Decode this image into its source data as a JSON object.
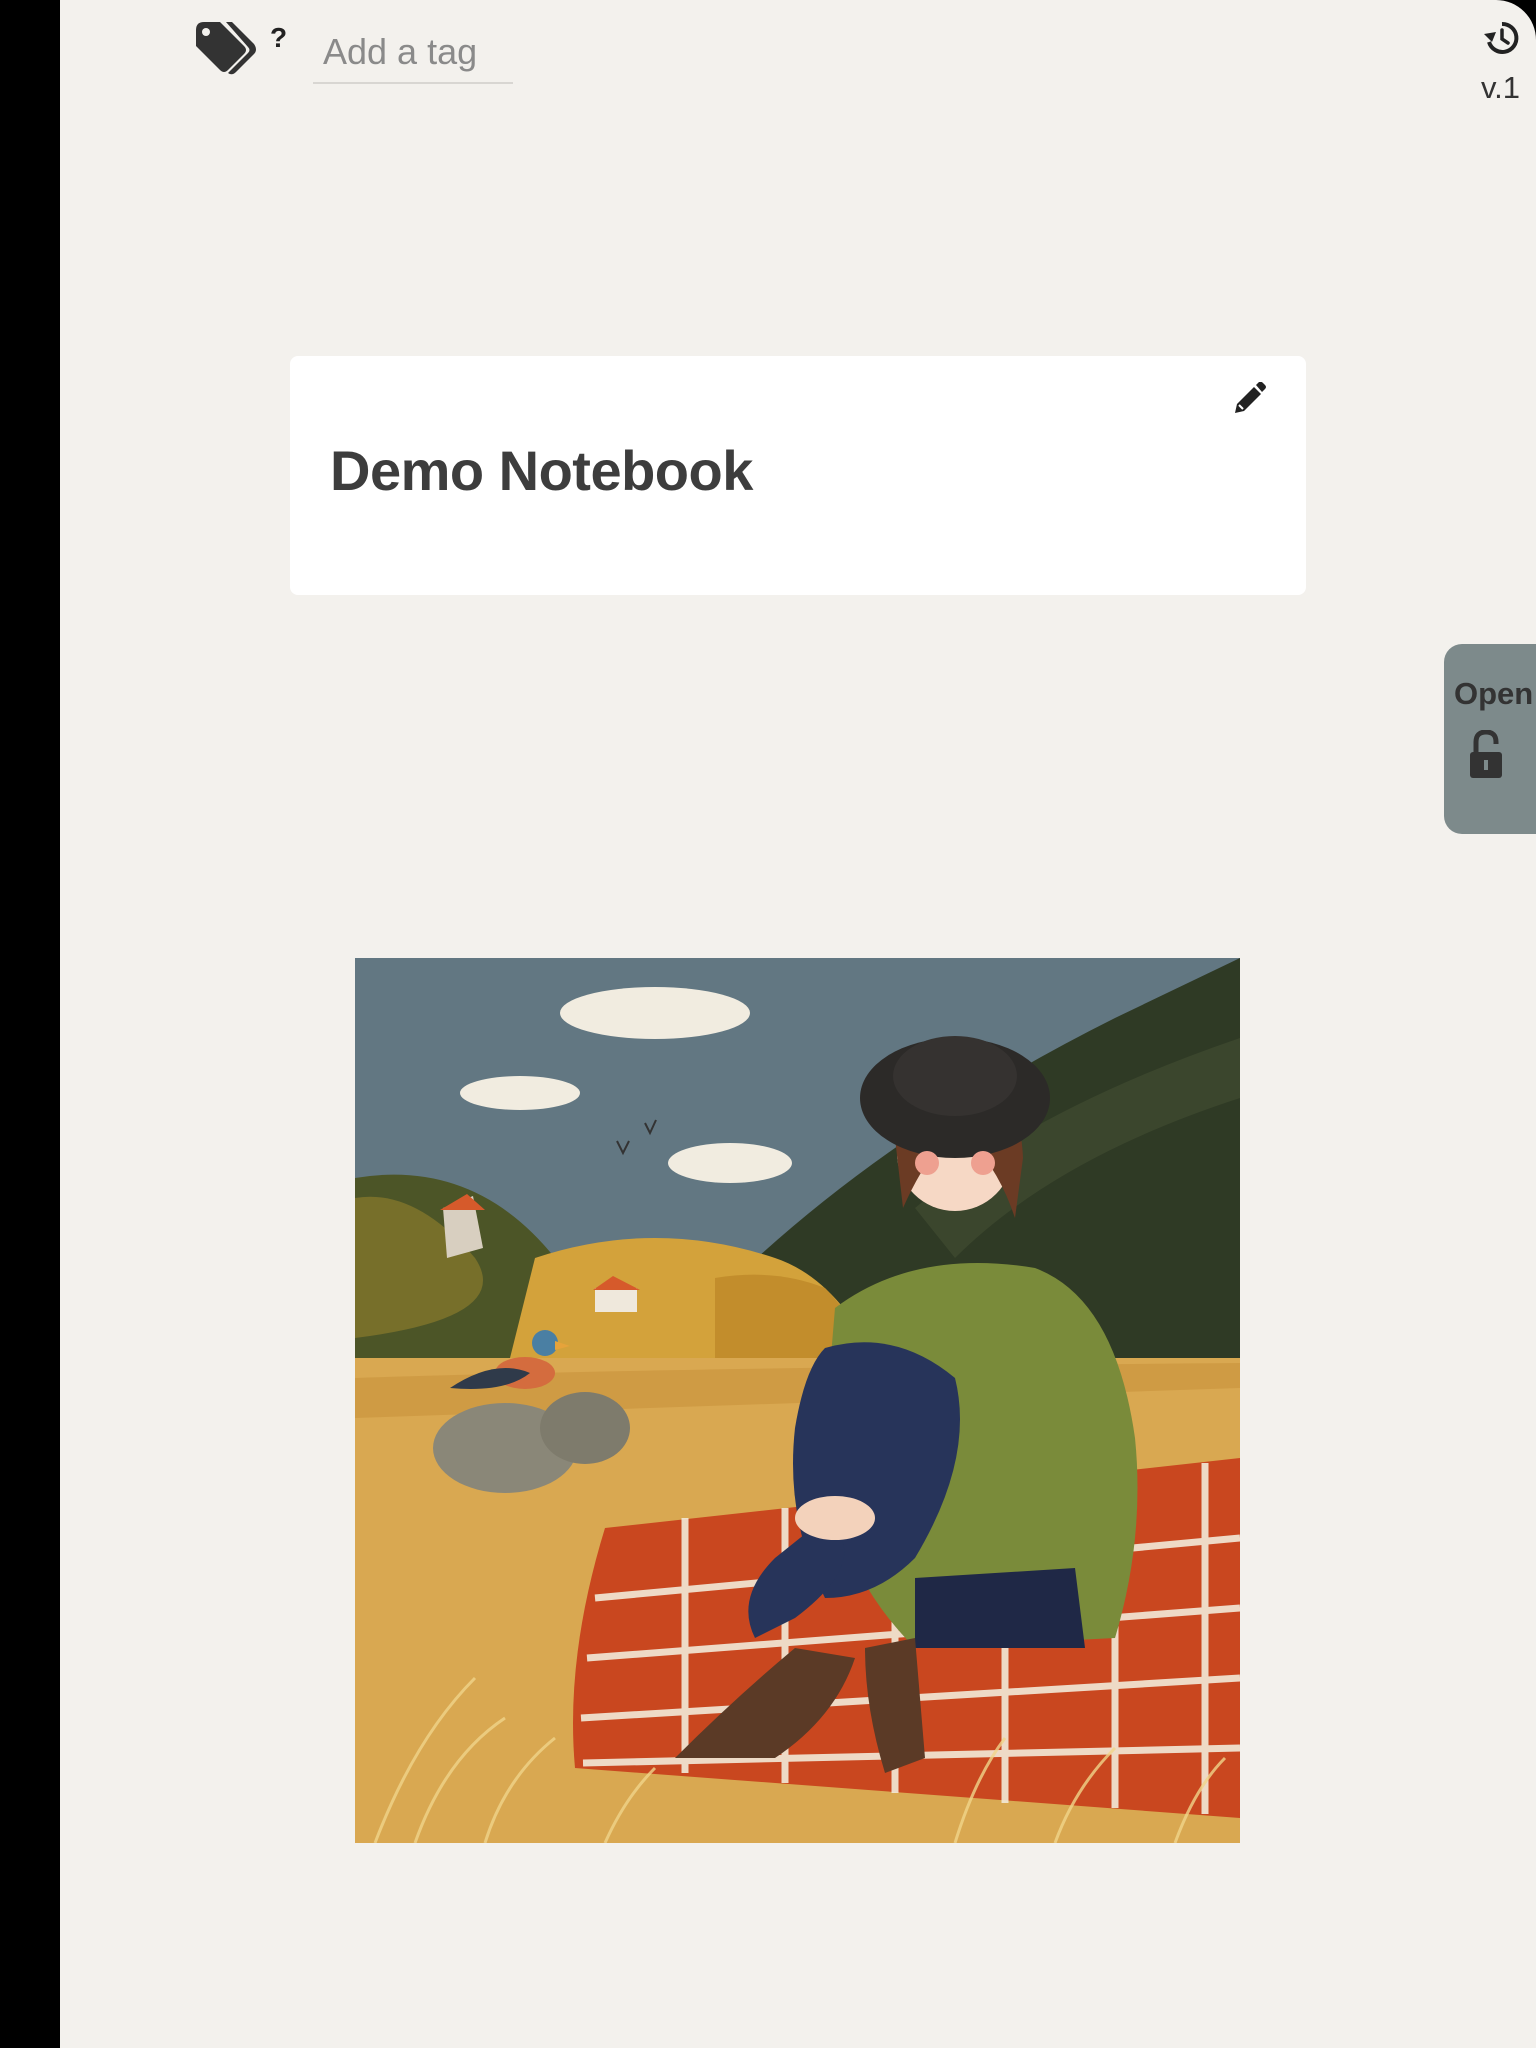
{
  "tag_bar": {
    "help_label": "?",
    "input_placeholder": "Add a tag",
    "input_value": ""
  },
  "version": {
    "label": "v.1"
  },
  "notebook": {
    "title": "Demo Notebook"
  },
  "lock_tab": {
    "label": "Open",
    "icon": "unlock-icon"
  },
  "icons": {
    "tags": "tags-icon",
    "history": "history-icon",
    "edit": "pencil-icon"
  },
  "colors": {
    "page_background": "#f3f1ed",
    "card_background": "#ffffff",
    "lock_tab_background": "#7d8a8b",
    "title_text": "#3d3d3d"
  }
}
